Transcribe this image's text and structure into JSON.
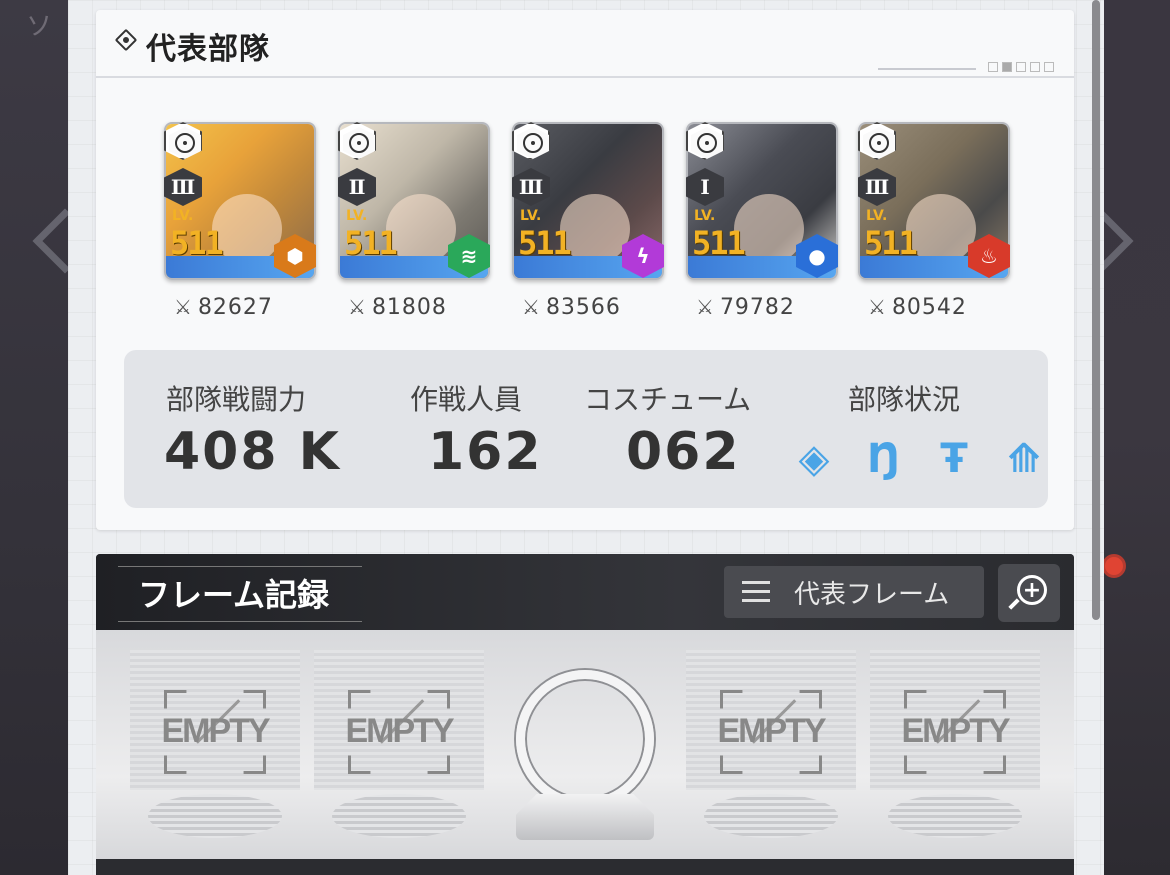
{
  "background": {
    "partial_text": "ソ"
  },
  "squad": {
    "title": "代表部隊",
    "members": [
      {
        "rank": "Ⅲ",
        "lv_label": "LV.",
        "level": "511",
        "power": "82627",
        "element": "iron",
        "element_color": "#d97a1a",
        "type_icon": "crosshair-icon"
      },
      {
        "rank": "Ⅱ",
        "lv_label": "LV.",
        "level": "511",
        "power": "81808",
        "element": "wind",
        "element_color": "#2aa85a",
        "type_icon": "crosshair-icon"
      },
      {
        "rank": "Ⅲ",
        "lv_label": "LV.",
        "level": "511",
        "power": "83566",
        "element": "electric",
        "element_color": "#b23ad8",
        "type_icon": "crosshair-icon"
      },
      {
        "rank": "Ⅰ",
        "lv_label": "LV.",
        "level": "511",
        "power": "79782",
        "element": "water",
        "element_color": "#2a6fd8",
        "type_icon": "crosshair-icon"
      },
      {
        "rank": "Ⅲ",
        "lv_label": "LV.",
        "level": "511",
        "power": "80542",
        "element": "fire",
        "element_color": "#d83a2a",
        "type_icon": "crosshair-icon"
      }
    ],
    "stats": {
      "power_label": "部隊戦闘力",
      "power_value": "408 K",
      "staff_label": "作戦人員",
      "staff_value": "162",
      "costume_label": "コスチューム",
      "costume_value": "062",
      "status_label": "部隊状況"
    },
    "status_color": "#4aa4e6"
  },
  "frames": {
    "title": "フレーム記録",
    "representative_button": "代表フレーム",
    "slots": [
      {
        "label": "EMPTY"
      },
      {
        "label": "EMPTY"
      },
      {
        "label": "EMPTY"
      },
      {
        "label": "EMPTY"
      }
    ]
  }
}
